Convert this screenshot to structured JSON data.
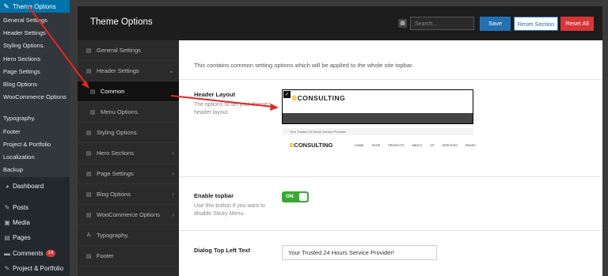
{
  "wp_sidebar": {
    "active_menu": "Theme Options",
    "submenu": [
      "General Settings",
      "Header Settings",
      "Styling Options.",
      "Hero Sections",
      "Page Settings",
      "Blog Options",
      "WooCommerce Options",
      "Typography.",
      "Footer",
      "Project & Portfolio",
      "Localization",
      "Backup"
    ],
    "menu": [
      {
        "label": "Dashboard",
        "icon": "dashboard-icon",
        "glyph": "◕"
      },
      {
        "label": "Posts",
        "icon": "pin-icon",
        "glyph": "✎"
      },
      {
        "label": "Media",
        "icon": "media-icon",
        "glyph": "▣"
      },
      {
        "label": "Pages",
        "icon": "pages-icon",
        "glyph": "▤"
      },
      {
        "label": "Comments",
        "icon": "comments-icon",
        "glyph": "▬",
        "badge": "14"
      },
      {
        "label": "Project & Portfolio",
        "icon": "portfolio-icon",
        "glyph": "✎"
      }
    ]
  },
  "panel": {
    "title": "Theme Options",
    "search_placeholder": "Search...",
    "buttons": {
      "save": "Save",
      "reset_section": "Reset Section",
      "reset_all": "Reset All"
    },
    "nav": [
      {
        "label": "General Settings",
        "chev": ""
      },
      {
        "label": "Header Settings",
        "chev": "⌄"
      },
      {
        "label": "Common",
        "chev": "",
        "active": true,
        "sub": true
      },
      {
        "label": "Menu Options.",
        "chev": "",
        "sub": true
      },
      {
        "label": "Styling Options.",
        "chev": ""
      },
      {
        "label": "Hero Sections",
        "chev": "›"
      },
      {
        "label": "Page Settings",
        "chev": "›"
      },
      {
        "label": "Blog Options",
        "chev": "›"
      },
      {
        "label": "WooCommerce Options",
        "chev": "›"
      },
      {
        "label": "Typography.",
        "chev": ""
      },
      {
        "label": "Footer",
        "chev": ""
      }
    ],
    "section_desc": "This contains common setting options which will be applied to the whole site topbar.",
    "header_layout": {
      "label": "Header Layout",
      "help": "The options to set your theme's header layout.",
      "logo_prefix": "B",
      "logo_text": "CONSULTING",
      "preview_topbar": "Your Trusted 24 Hours Service Provider!",
      "preview_menu": "HOME SHOP PROJECTS ABOUT US SERVICES PAGES"
    },
    "enable_topbar": {
      "label": "Enable topbar",
      "help": "Use this button if you want to disable Sticky Menu.",
      "state": "ON"
    },
    "dialog_text": {
      "label": "Dialog Top Left Text",
      "value": "Your Trusted 24 Hours Service Provider!"
    }
  },
  "colors": {
    "accent": "#2271b1",
    "danger": "#d63638",
    "toggle": "#3aa832",
    "arrow": "#e32626"
  }
}
